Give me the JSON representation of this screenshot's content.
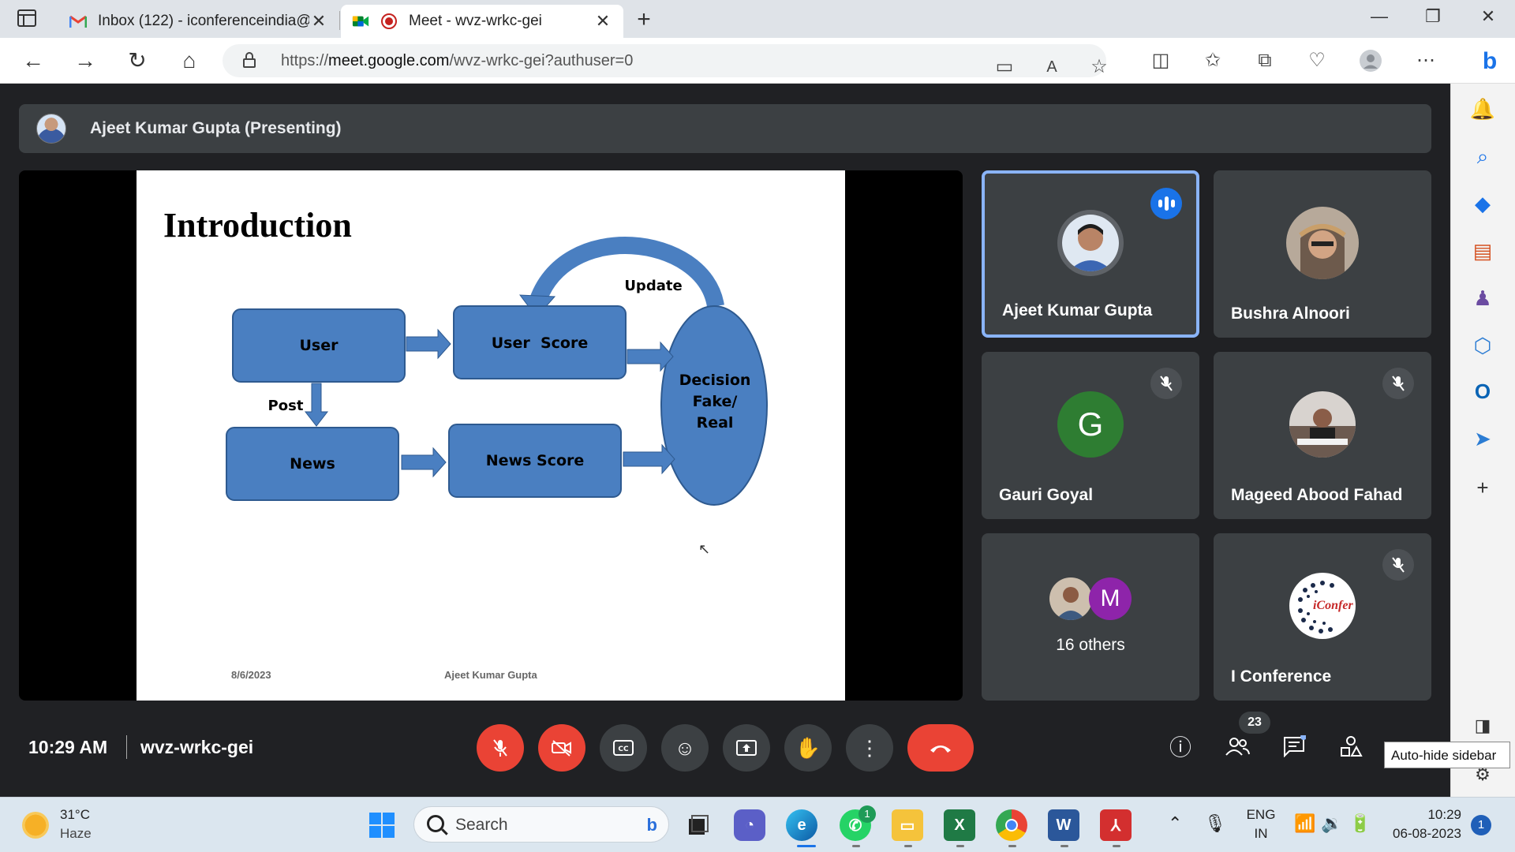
{
  "browser": {
    "tabs": [
      {
        "title": "Inbox (122) - iconferenceindia@g",
        "icon": "gmail-icon"
      },
      {
        "title": "Meet - wvz-wrkc-gei",
        "icon": "meet-icon",
        "active": true
      }
    ],
    "url_prefix": "https://",
    "url_host": "meet.google.com",
    "url_path": "/wvz-wrkc-gei?authuser=0"
  },
  "meet": {
    "presenter_label": "Ajeet Kumar Gupta (Presenting)",
    "slide": {
      "title": "Introduction",
      "nodes": {
        "user": "User",
        "user_score": "User  Score",
        "news": "News",
        "news_score": "News Score",
        "decision_line1": "Decision",
        "decision_line2": "Fake/",
        "decision_line3": "Real",
        "post": "Post",
        "update": "Update"
      },
      "footer_date": "8/6/2023",
      "footer_author": "Ajeet Kumar Gupta"
    },
    "participants": [
      {
        "name": "Ajeet Kumar Gupta",
        "speaking": true
      },
      {
        "name": "Bushra Alnoori"
      },
      {
        "name": "Gauri Goyal",
        "initial": "G",
        "avatar_color": "#2e7d32",
        "muted": true
      },
      {
        "name": "Mageed Abood Fahad",
        "muted": true
      },
      {
        "others_label": "16 others",
        "initial": "M",
        "avatar_color": "#8e24aa"
      },
      {
        "name": "I Conference",
        "muted": true,
        "logo_text": "iConfer"
      }
    ],
    "time": "10:29 AM",
    "meeting_code": "wvz-wrkc-gei",
    "participant_count": "23"
  },
  "sidebar": {
    "tooltip": "Auto-hide sidebar"
  },
  "taskbar": {
    "temperature": "31°C",
    "condition": "Haze",
    "search_placeholder": "Search",
    "whatsapp_badge": "1",
    "language_line1": "ENG",
    "language_line2": "IN",
    "clock_time": "10:29",
    "clock_date": "06-08-2023",
    "notification_count": "1"
  },
  "colors": {
    "meet_bg": "#202124",
    "tile_bg": "#3c4043",
    "danger": "#ea4335",
    "speaker_border": "#8ab4f8",
    "diagram_fill": "#4a7fc1"
  }
}
